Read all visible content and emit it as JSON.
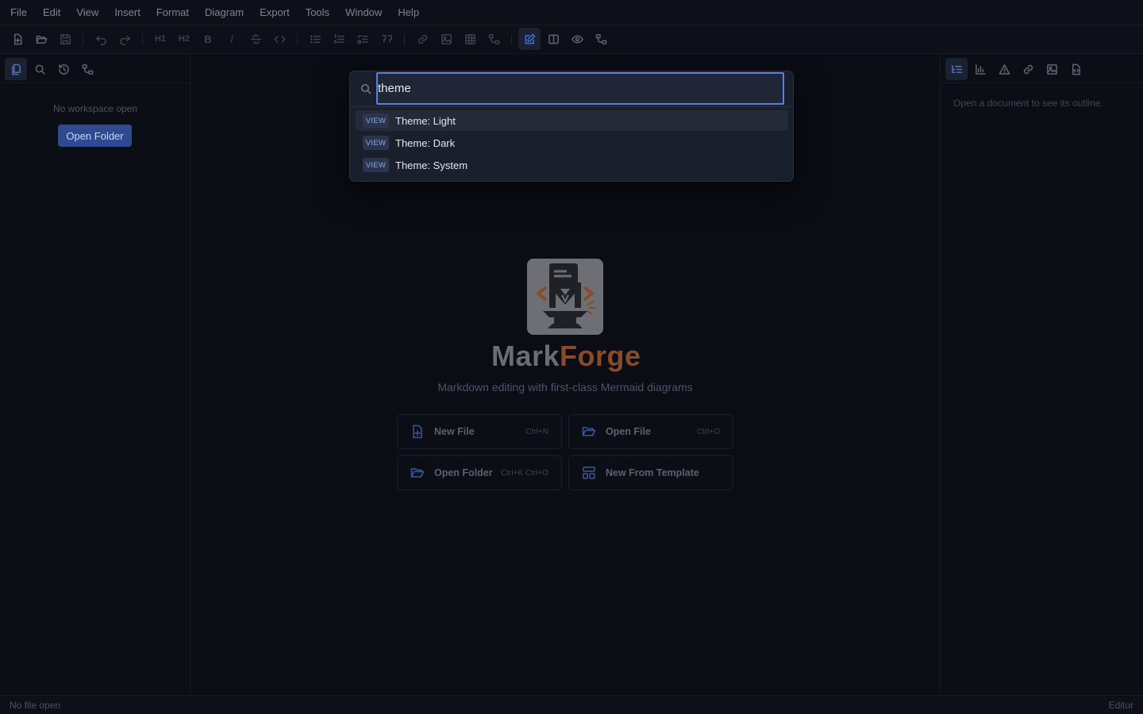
{
  "menu": [
    "File",
    "Edit",
    "View",
    "Insert",
    "Format",
    "Diagram",
    "Export",
    "Tools",
    "Window",
    "Help"
  ],
  "toolbar": {
    "h1": "H1",
    "h2": "H2",
    "bold": "B",
    "italic": "I"
  },
  "left_sidebar": {
    "empty_text": "No workspace open",
    "open_folder_label": "Open Folder"
  },
  "right_sidebar": {
    "outline_hint": "Open a document to see its outline."
  },
  "welcome": {
    "brand_mark": "Mark",
    "brand_forge": "Forge",
    "tagline": "Markdown editing with first-class Mermaid diagrams",
    "actions": [
      {
        "label": "New File",
        "shortcut": "Ctrl+N",
        "icon": "file-plus-icon"
      },
      {
        "label": "Open File",
        "shortcut": "Ctrl+O",
        "icon": "folder-open-icon"
      },
      {
        "label": "Open Folder",
        "shortcut": "Ctrl+K Ctrl+O",
        "icon": "folder-icon"
      },
      {
        "label": "New From Template",
        "shortcut": "",
        "icon": "template-icon"
      }
    ]
  },
  "palette": {
    "query": "theme",
    "results": [
      {
        "category": "VIEW",
        "label": "Theme: Light"
      },
      {
        "category": "VIEW",
        "label": "Theme: Dark"
      },
      {
        "category": "VIEW",
        "label": "Theme: System"
      }
    ]
  },
  "status": {
    "left": "No file open",
    "right": "Editor"
  },
  "colors": {
    "accent": "#5b7fe0",
    "brand_orange": "#8a4a27",
    "background": "#0a0d14"
  }
}
